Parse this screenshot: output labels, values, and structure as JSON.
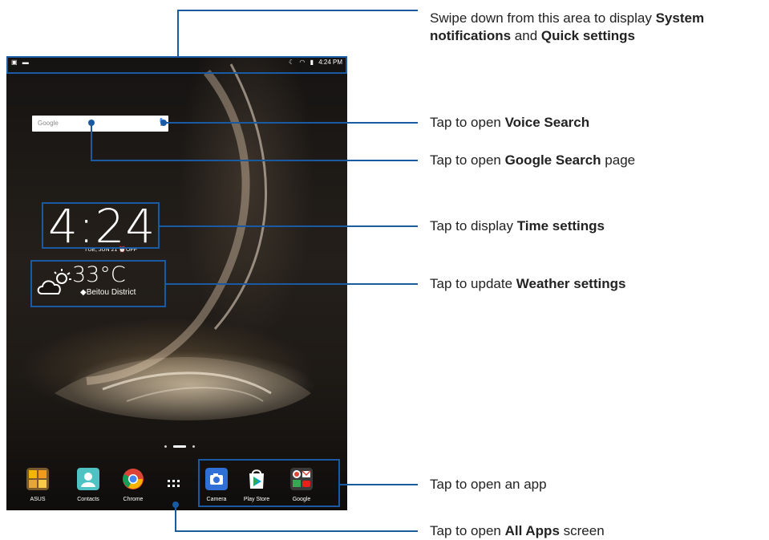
{
  "status_bar": {
    "left_icons": [
      "image-icon",
      "window-icon"
    ],
    "right_icons": [
      "moon-icon",
      "wifi-icon",
      "battery-icon"
    ],
    "time": "4:24 PM"
  },
  "home_screen": {
    "search_logo": "Google",
    "clock_time": "4:24",
    "date": "TUE, JUN 21",
    "alarm": "OFF",
    "temperature": "33°C",
    "location": "Beitou District",
    "dock": [
      {
        "label": "ASUS"
      },
      {
        "label": "Contacts"
      },
      {
        "label": "Chrome"
      },
      {
        "label": "Camera"
      },
      {
        "label": "Play Store"
      },
      {
        "label": "Google"
      }
    ]
  },
  "callouts": {
    "notifications": {
      "pre": "Swipe down from this area to display ",
      "b1": "System",
      "b2": "notifications",
      "mid": " and ",
      "b3": "Quick settings"
    },
    "voice": {
      "pre": "Tap to open ",
      "bold": "Voice Search",
      "post": ""
    },
    "google": {
      "pre": "Tap to open ",
      "bold": "Google Search",
      "post": " page"
    },
    "time": {
      "pre": "Tap to display ",
      "bold": "Time settings",
      "post": ""
    },
    "weather": {
      "pre": "Tap to update ",
      "bold": "Weather settings",
      "post": ""
    },
    "app": {
      "pre": "Tap to open an app",
      "bold": "",
      "post": ""
    },
    "all_apps": {
      "pre": "Tap to open ",
      "bold": "All Apps",
      "post": " screen"
    }
  },
  "colors": {
    "annotation": "#1a5aa3"
  }
}
